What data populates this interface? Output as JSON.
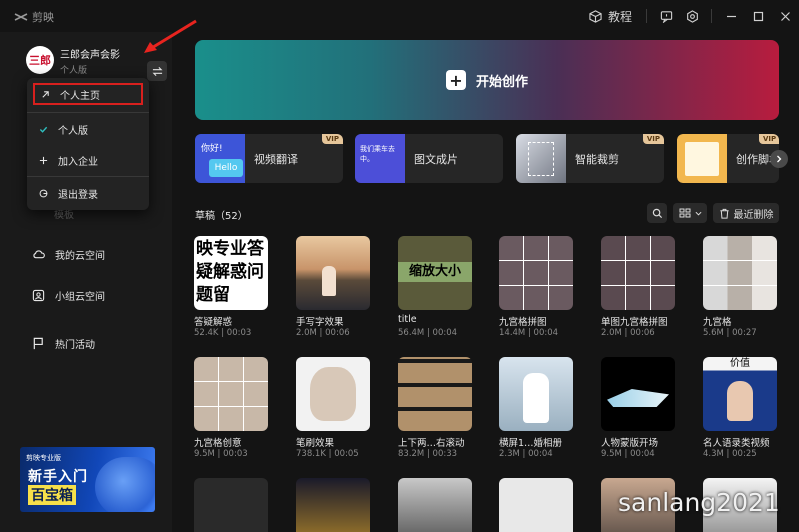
{
  "app": {
    "name": "剪映"
  },
  "titlebar": {
    "tutorial_label": "教程"
  },
  "profile": {
    "avatar_text": "三郎",
    "name": "三郎会声会影",
    "version": "个人版"
  },
  "profile_menu": {
    "items": [
      {
        "label": "个人主页"
      },
      {
        "label": "个人版"
      },
      {
        "label": "加入企业"
      },
      {
        "label": "退出登录"
      }
    ]
  },
  "sidebar": {
    "partial_label": "模板",
    "items": [
      {
        "label": "我的云空间"
      },
      {
        "label": "小组云空间"
      },
      {
        "label": "热门活动"
      }
    ]
  },
  "banner": {
    "tag": "剪映专业版",
    "line1": "新手入门",
    "line2": "百宝箱"
  },
  "create": {
    "label": "开始创作"
  },
  "tools": [
    {
      "label": "视频翻译",
      "vip": "VIP",
      "thumb_text": "你好!"
    },
    {
      "label": "图文成片",
      "thumb_text": "我们乘车去中。"
    },
    {
      "label": "智能裁剪",
      "vip": "VIP"
    },
    {
      "label": "创作脚本",
      "vip": "VIP"
    }
  ],
  "drafts": {
    "title": "草稿（52）",
    "recent_delete": "最近删除",
    "items": [
      {
        "title": "答疑解惑",
        "size": "52.4K",
        "duration": "00:03",
        "overlay": "映专业答疑解惑问题留"
      },
      {
        "title": "手写字效果",
        "size": "2.0M",
        "duration": "00:06"
      },
      {
        "title": "title",
        "size": "56.4M",
        "duration": "00:04",
        "overlay": "缩放大小"
      },
      {
        "title": "九宫格拼图",
        "size": "14.4M",
        "duration": "00:04"
      },
      {
        "title": "单图九宫格拼图",
        "size": "2.0M",
        "duration": "00:06"
      },
      {
        "title": "九宫格",
        "size": "5.6M",
        "duration": "00:27"
      },
      {
        "title": "九宫格创意",
        "size": "9.5M",
        "duration": "00:03"
      },
      {
        "title": "笔刷效果",
        "size": "738.1K",
        "duration": "00:05"
      },
      {
        "title": "上下两…右滚动",
        "size": "83.2M",
        "duration": "00:33"
      },
      {
        "title": "横屏1…婚相册",
        "size": "2.3M",
        "duration": "00:04"
      },
      {
        "title": "人物蒙版开场",
        "size": "9.5M",
        "duration": "00:04"
      },
      {
        "title": "名人语录类视频",
        "size": "4.3M",
        "duration": "00:25",
        "overlay": "价值"
      }
    ]
  },
  "watermark": "sanlang2021",
  "colors": {
    "accent_red": "#d8201e",
    "bg": "#141414",
    "sidebar": "#1a1a1a",
    "vip_gold": "#e6c69a"
  }
}
